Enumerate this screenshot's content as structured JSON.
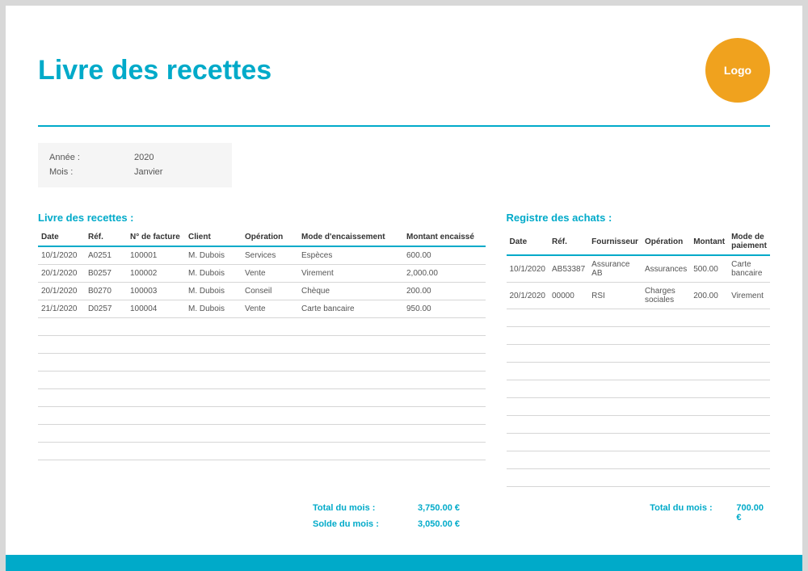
{
  "title": "Livre des recettes",
  "logo_text": "Logo",
  "info": {
    "year_label": "Année :",
    "year_value": "2020",
    "month_label": "Mois :",
    "month_value": "Janvier"
  },
  "recettes": {
    "section_title": "Livre des recettes :",
    "headers": [
      "Date",
      "Réf.",
      "N° de facture",
      "Client",
      "Opération",
      "Mode d'encaissement",
      "Montant encaissé"
    ],
    "rows": [
      [
        "10/1/2020",
        "A0251",
        "100001",
        "M. Dubois",
        "Services",
        "Espèces",
        "600.00"
      ],
      [
        "20/1/2020",
        "B0257",
        "100002",
        "M. Dubois",
        "Vente",
        "Virement",
        "2,000.00"
      ],
      [
        "20/1/2020",
        "B0270",
        "100003",
        "M. Dubois",
        "Conseil",
        "Chèque",
        "200.00"
      ],
      [
        "21/1/2020",
        "D0257",
        "100004",
        "M. Dubois",
        "Vente",
        "Carte bancaire",
        "950.00"
      ]
    ],
    "empty_rows": 8,
    "total_label": "Total du mois :",
    "total_value": "3,750.00 €",
    "balance_label": "Solde du mois :",
    "balance_value": "3,050.00 €"
  },
  "achats": {
    "section_title": "Registre des achats :",
    "headers": [
      "Date",
      "Réf.",
      "Fournisseur",
      "Opération",
      "Montant",
      "Mode de paiement"
    ],
    "rows": [
      [
        "10/1/2020",
        "AB53387",
        "Assurance AB",
        "Assurances",
        "500.00",
        "Carte bancaire"
      ],
      [
        "20/1/2020",
        "00000",
        "RSI",
        "Charges sociales",
        "200.00",
        "Virement"
      ]
    ],
    "empty_rows": 10,
    "total_label": "Total du mois :",
    "total_value": "700.00 €"
  }
}
